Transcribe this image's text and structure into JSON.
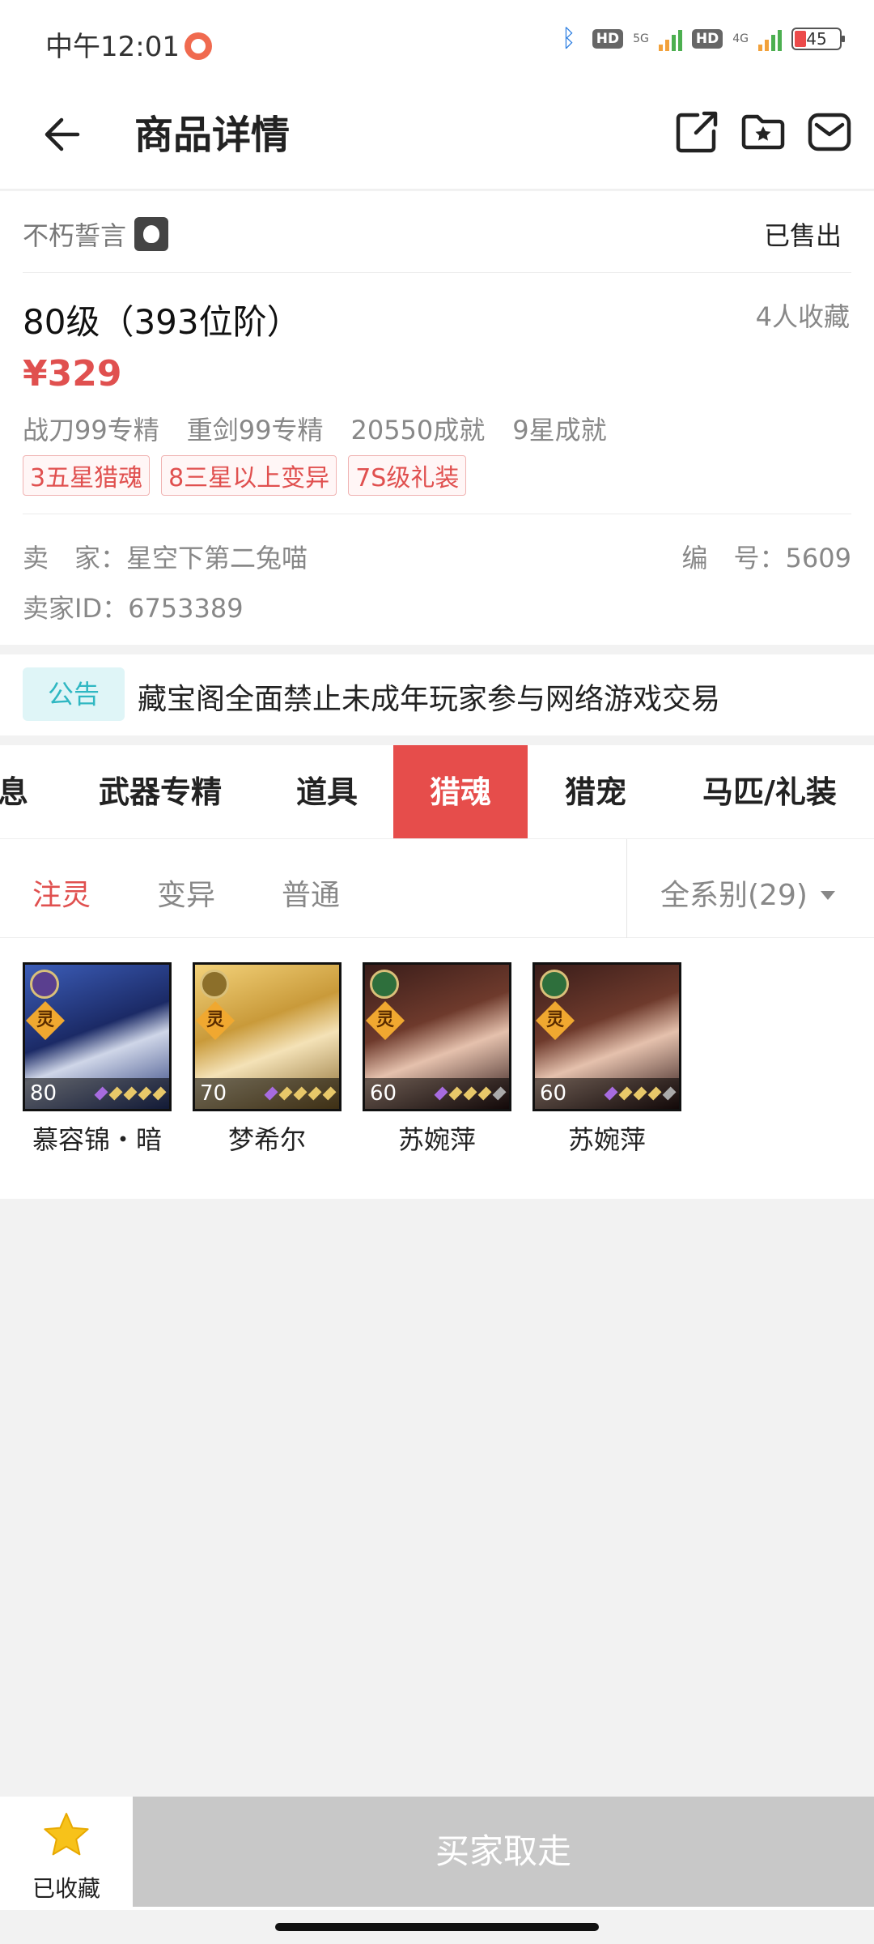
{
  "status": {
    "time": "中午12:01",
    "net1": "5G",
    "net2": "4G",
    "hd": "HD",
    "battery": "45"
  },
  "header": {
    "title": "商品详情"
  },
  "product": {
    "server": "不朽誓言",
    "sold_status": "已售出",
    "level": "80级（393位阶）",
    "favorites": "4人收藏",
    "price": "¥329",
    "attrs": [
      "战刀99专精",
      "重剑99专精",
      "20550成就",
      "9星成就"
    ],
    "tags": [
      "3五星猎魂",
      "8三星以上变异",
      "7S级礼装"
    ],
    "seller": "卖　家：星空下第二兔喵",
    "serial": "编　号：5609",
    "seller_id": "卖家ID：6753389"
  },
  "notice": {
    "badge": "公告",
    "text": "藏宝阁全面禁止未成年玩家参与网络游戏交易"
  },
  "tabs": [
    "息",
    "武器专精",
    "道具",
    "猎魂",
    "猎宠",
    "马匹/礼装"
  ],
  "active_tab": "猎魂",
  "subfilter": {
    "tabs": [
      "注灵",
      "变异",
      "普通"
    ],
    "active": "注灵",
    "series": "全系别(29)"
  },
  "items": [
    {
      "name": "慕容锦・暗",
      "level": "80",
      "badge": "灵"
    },
    {
      "name": "梦希尔",
      "level": "70",
      "badge": "灵"
    },
    {
      "name": "苏婉萍",
      "level": "60",
      "badge": "灵"
    },
    {
      "name": "苏婉萍",
      "level": "60",
      "badge": "灵"
    }
  ],
  "bottom": {
    "fav_label": "已收藏",
    "buy_label": "买家取走"
  },
  "colors": {
    "accent": "#e64d4b",
    "price": "#e0504f",
    "notice_badge_bg": "#dff5f7",
    "notice_badge_fg": "#2fb7c2",
    "star": "#f7c21a",
    "disabled_button": "#c8c8c8"
  }
}
